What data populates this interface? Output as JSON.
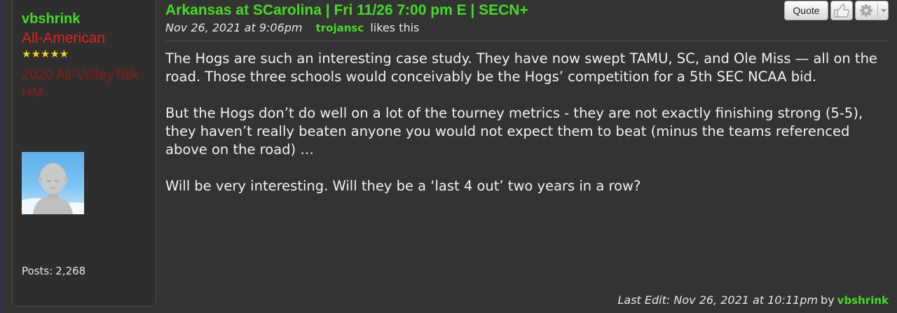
{
  "user": {
    "username": "vbshrink",
    "rank": "All-American",
    "stars": "★★★★★",
    "award": "2020 All-VolleyTalk HM",
    "posts_label": "Posts:",
    "posts_count": "2,268"
  },
  "post": {
    "title": "Arkansas at SCarolina | Fri 11/26 7:00 pm E | SECN+",
    "date": "Nov 26, 2021 at 9:06pm",
    "liker": "trojansc",
    "likes_text": "likes this",
    "paragraphs": [
      "The Hogs are such an interesting case study. They have now swept TAMU, SC, and Ole Miss — all on the road. Those three schools would conceivably be the Hogs’ competition for a 5th SEC NCAA bid.",
      "But the Hogs don’t do well on a lot of the tourney metrics - they are not exactly finishing strong (5-5), they haven’t really beaten anyone you would not expect them to beat (minus the teams referenced above on the road) …",
      "Will be very interesting. Will they be a ‘last 4 out’ two years in a row?"
    ],
    "last_edit": "Last Edit: Nov 26, 2021 at 10:11pm",
    "by_text": "by",
    "editor": "vbshrink"
  },
  "buttons": {
    "quote_label": "Quote",
    "like_icon": "thumbs-up-icon",
    "options_icon": "gear-icon"
  },
  "colors": {
    "accent_green": "#44dd22",
    "rank_red": "#dd2222",
    "background": "#333333"
  }
}
